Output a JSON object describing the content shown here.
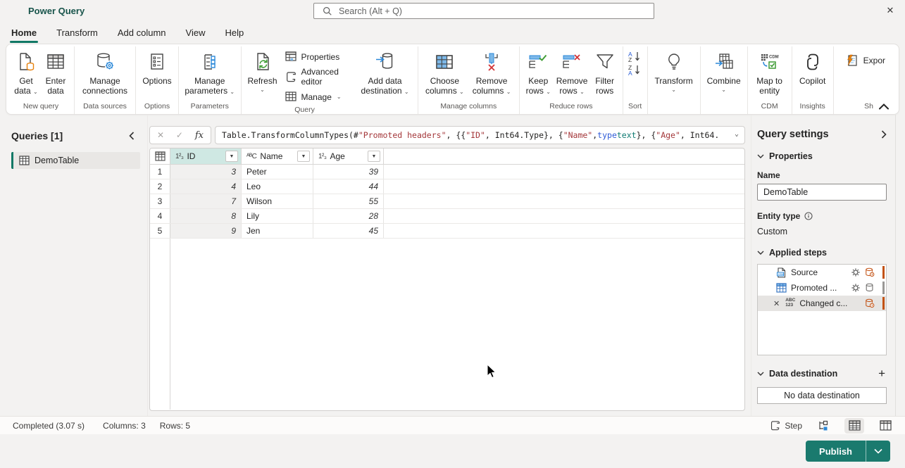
{
  "title_bar": {
    "app_title": "Power Query",
    "search_placeholder": "Search (Alt + Q)",
    "close_glyph": "✕"
  },
  "tabs": {
    "home": "Home",
    "transform": "Transform",
    "add_column": "Add column",
    "view": "View",
    "help": "Help"
  },
  "ribbon": {
    "buttons": {
      "get_data": "Get data",
      "enter_data": "Enter data",
      "manage_connections": "Manage connections",
      "options": "Options",
      "manage_parameters": "Manage parameters",
      "refresh": "Refresh",
      "properties": "Properties",
      "advanced_editor": "Advanced editor",
      "manage": "Manage",
      "add_data_destination": "Add data destination",
      "choose_columns": "Choose columns",
      "remove_columns": "Remove columns",
      "keep_rows": "Keep rows",
      "remove_rows": "Remove rows",
      "filter_rows": "Filter rows",
      "transform": "Transform",
      "combine": "Combine",
      "map_to_entity": "Map to entity",
      "copilot": "Copilot",
      "export": "Expor"
    },
    "group_labels": {
      "new_query": "New query",
      "data_sources": "Data sources",
      "options": "Options",
      "parameters": "Parameters",
      "query": "Query",
      "manage_columns": "Manage columns",
      "reduce_rows": "Reduce rows",
      "sort": "Sort",
      "cdm": "CDM",
      "insights": "Insights",
      "share": "Sh"
    }
  },
  "queries_pane": {
    "title": "Queries [1]",
    "items": [
      {
        "label": "DemoTable"
      }
    ]
  },
  "formula_bar": {
    "fx": "fx",
    "cancel_glyph": "✕",
    "commit_glyph": "✓",
    "segments": [
      {
        "t": "Table.TransformColumnTypes(#"
      },
      {
        "t": "\"Promoted headers\""
      },
      {
        "t": ", {{"
      },
      {
        "t": "\"ID\""
      },
      {
        "t": ", Int64.Type}, {"
      },
      {
        "t": "\"Name\""
      },
      {
        "t": ", "
      },
      {
        "t": "type"
      },
      {
        "t": " "
      },
      {
        "t": "text"
      },
      {
        "t": "}, {"
      },
      {
        "t": "\"Age\""
      },
      {
        "t": ", Int64."
      }
    ]
  },
  "grid": {
    "columns": [
      {
        "name": "ID",
        "type_icon": "1²₃"
      },
      {
        "name": "Name",
        "type_icon": "ᴬᴮC"
      },
      {
        "name": "Age",
        "type_icon": "1²₃"
      }
    ],
    "rows": [
      {
        "num": "1",
        "id": "3",
        "name": "Peter",
        "age": "39"
      },
      {
        "num": "2",
        "id": "4",
        "name": "Leo",
        "age": "44"
      },
      {
        "num": "3",
        "id": "7",
        "name": "Wilson",
        "age": "55"
      },
      {
        "num": "4",
        "id": "8",
        "name": "Lily",
        "age": "28"
      },
      {
        "num": "5",
        "id": "9",
        "name": "Jen",
        "age": "45"
      }
    ]
  },
  "settings": {
    "title": "Query settings",
    "properties_header": "Properties",
    "name_label": "Name",
    "name_value": "DemoTable",
    "entity_type_label": "Entity type",
    "entity_type_value": "Custom",
    "applied_steps_header": "Applied steps",
    "steps": [
      {
        "label": "Source"
      },
      {
        "label": "Promoted ..."
      },
      {
        "label": "Changed c..."
      }
    ],
    "abc_icon_top": "ABC",
    "abc_icon_bottom": "123",
    "data_destination_header": "Data destination",
    "no_destination": "No data destination"
  },
  "status_bar": {
    "completed": "Completed (3.07 s)",
    "columns": "Columns: 3",
    "rows": "Rows: 5",
    "step": "Step"
  },
  "footer": {
    "publish": "Publish"
  },
  "colors": {
    "accent": "#117865",
    "publish": "#1a7a6e",
    "selected_column_header": "#cfe8e3",
    "step_flag_orange": "#c35214"
  }
}
